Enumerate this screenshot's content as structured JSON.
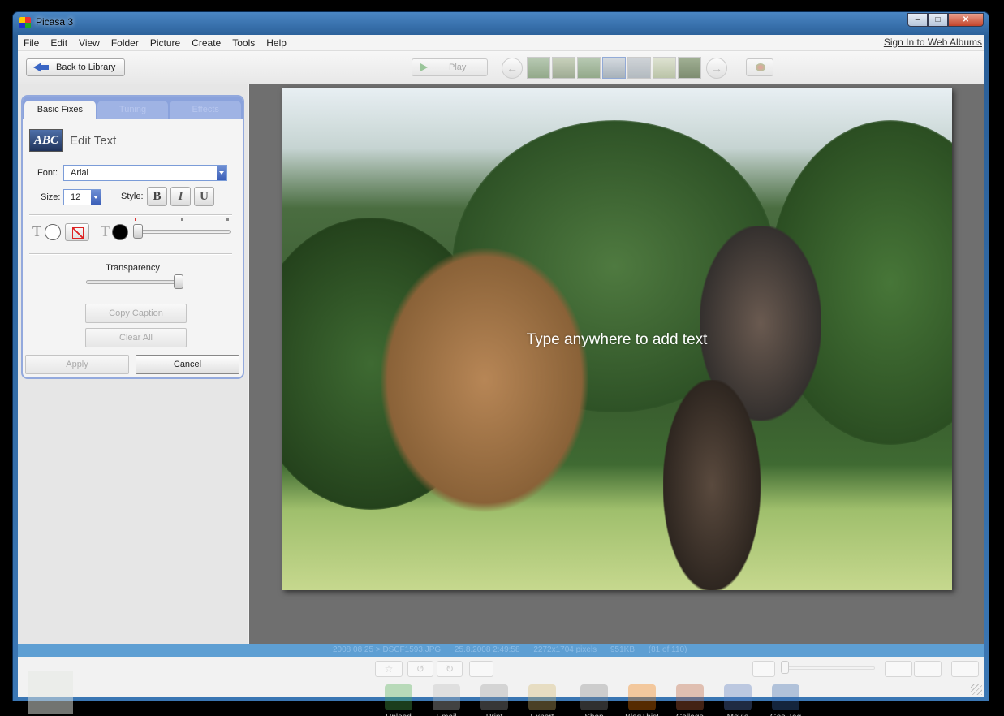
{
  "window": {
    "title": "Picasa 3",
    "minimize": "–",
    "maximize": "□",
    "close": "✕"
  },
  "menu": [
    "File",
    "Edit",
    "View",
    "Folder",
    "Picture",
    "Create",
    "Tools",
    "Help"
  ],
  "signin_link": "Sign In to Web Albums",
  "toolbar": {
    "back_label": "Back to Library",
    "play_label": "Play",
    "prev_icon": "left-arrow-icon",
    "next_icon": "right-arrow-icon",
    "thumbnail_count": 7
  },
  "edit_panel": {
    "tabs": [
      "Basic Fixes",
      "Tuning",
      "Effects"
    ],
    "active_tab": "Basic Fixes",
    "title": "Edit Text",
    "icon_text": "ABC",
    "font_label": "Font:",
    "font_value": "Arial",
    "size_label": "Size:",
    "size_value": "12",
    "style_label": "Style:",
    "bold": "B",
    "italic": "I",
    "underline": "U",
    "text_glyph": "T",
    "fill_color": "#ffffff",
    "text_color": "#000000",
    "transparency_label": "Transparency",
    "transparency_value": 1.0,
    "outline_value": 0.0,
    "copy_caption": "Copy Caption",
    "clear_all": "Clear All",
    "apply": "Apply",
    "cancel": "Cancel"
  },
  "photo": {
    "placeholder": "Type anywhere to add text"
  },
  "infobar": {
    "path": "2008 08 25 > DSCF1593.JPG",
    "date": "25.8.2008 2:49:58",
    "dimensions": "2272x1704 pixels",
    "size": "951KB",
    "position": "(81 of 110)"
  },
  "tray": {
    "tools": [
      {
        "label": "Upload",
        "icon": "upload-icon",
        "color": "#4caf50"
      },
      {
        "label": "Email",
        "icon": "email-icon",
        "color": "#bdbdbd"
      },
      {
        "label": "Print",
        "icon": "print-icon",
        "color": "#9e9e9e"
      },
      {
        "label": "Export",
        "icon": "export-folder-icon",
        "color": "#d4b86a"
      },
      {
        "label": "Shop",
        "icon": "shop-icon",
        "color": "#8a8a8a"
      },
      {
        "label": "BlogThis!",
        "icon": "blogger-icon",
        "color": "#f57c00"
      },
      {
        "label": "Collage",
        "icon": "collage-icon",
        "color": "#c0603a"
      },
      {
        "label": "Movie",
        "icon": "movie-icon",
        "color": "#5a7ac0"
      },
      {
        "label": "Geo-Tag",
        "icon": "geo-tag-icon",
        "color": "#3a6ab0"
      }
    ],
    "star": "☆",
    "rotate_left": "↺",
    "rotate_right": "↻"
  },
  "colors": {
    "accent": "#8aa2dc",
    "infobar": "#5e9fd3",
    "photo_bg": "#6f6f6f"
  }
}
